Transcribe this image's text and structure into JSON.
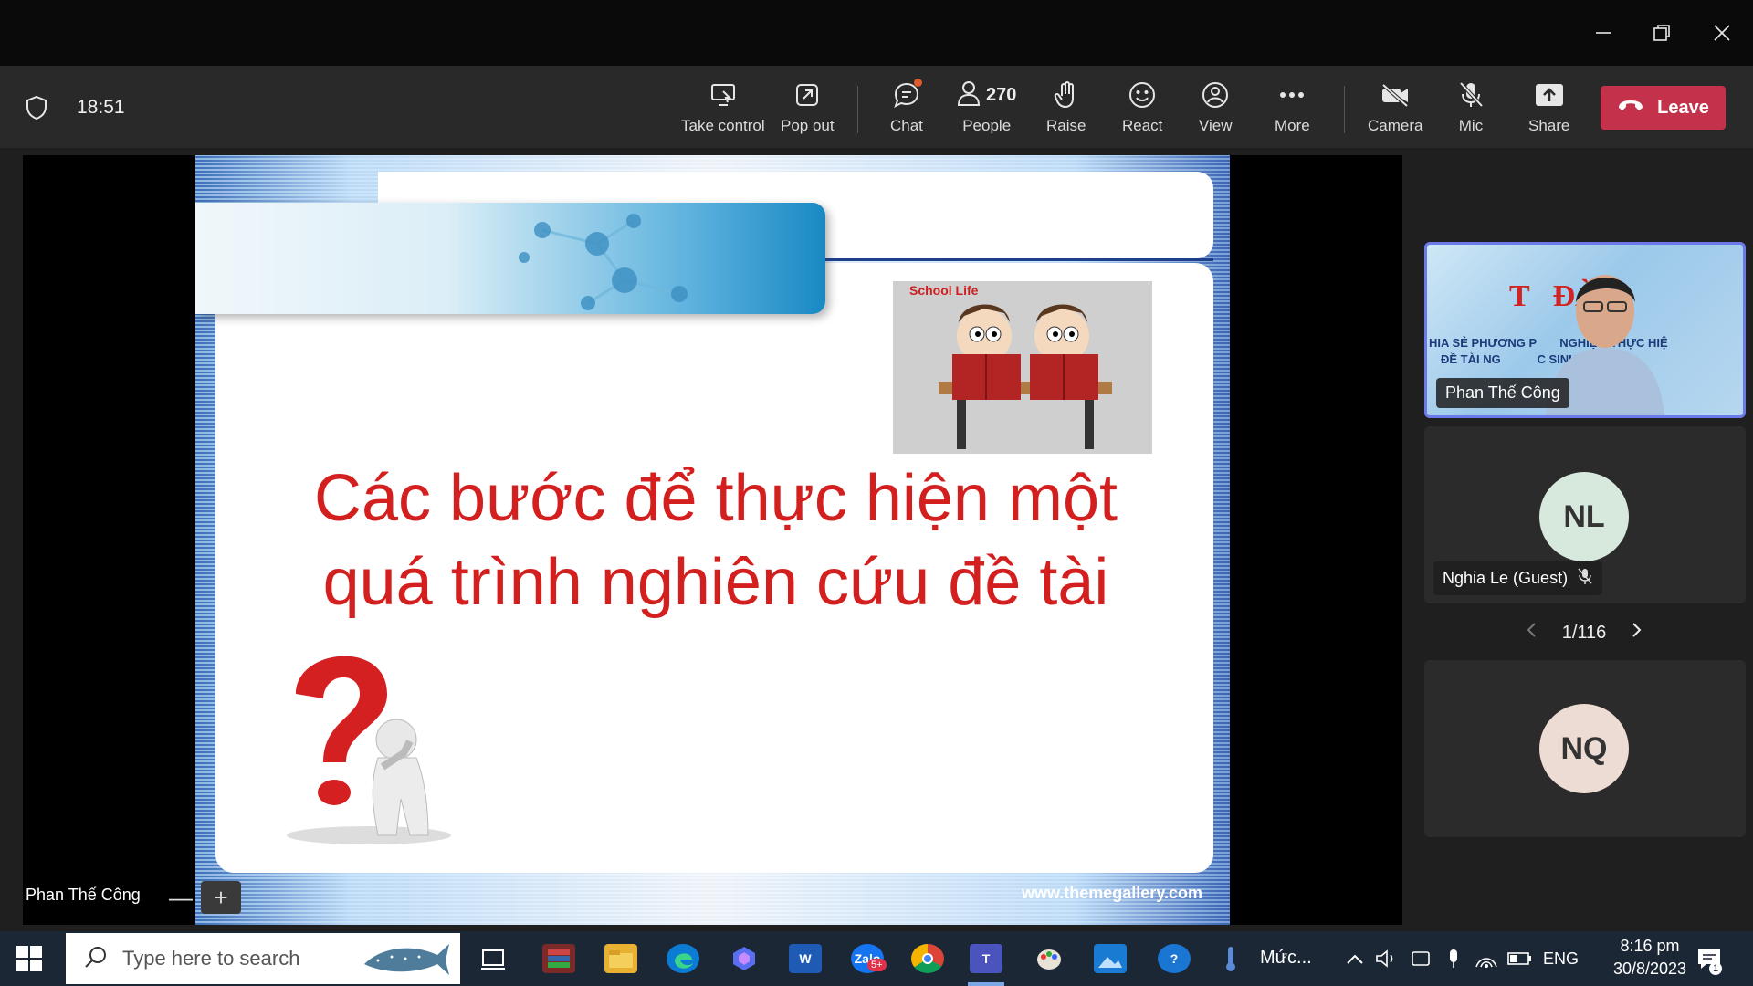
{
  "window": {
    "controls": [
      "minimize-icon",
      "restore-icon",
      "close-icon"
    ]
  },
  "toolbar": {
    "clock": "18:51",
    "items": [
      {
        "label": "Take control",
        "icon": "take-control-icon"
      },
      {
        "label": "Pop out",
        "icon": "pop-out-icon"
      },
      {
        "label": "Chat",
        "icon": "chat-icon"
      },
      {
        "label": "People",
        "icon": "people-icon",
        "count": "270"
      },
      {
        "label": "Raise",
        "icon": "hand-icon"
      },
      {
        "label": "React",
        "icon": "smiley-icon"
      },
      {
        "label": "View",
        "icon": "view-icon"
      },
      {
        "label": "More",
        "icon": "ellipsis-icon"
      },
      {
        "label": "Camera",
        "icon": "camera-off-icon"
      },
      {
        "label": "Mic",
        "icon": "mic-off-icon"
      },
      {
        "label": "Share",
        "icon": "share-icon"
      }
    ],
    "leave_label": "Leave"
  },
  "stage": {
    "slide": {
      "title_line1": "Các bước để thực hiện một",
      "title_line2": "quá trình nghiên cứu đề tài",
      "image_label": "School Life",
      "footer": "www.themegallery.com"
    },
    "presenter_name": "Phan Thế Công",
    "zoom_out": "—",
    "zoom_in": "+"
  },
  "participants": {
    "video_tile": {
      "name": "Phan Thế Công",
      "bg_title": "T   ĐÀM",
      "bg_line1": "HIA SẺ PHƯƠNG P       NGHIỆM THỰC HIỆ",
      "bg_line2": "ĐỀ TÀI NG           C SINH VIÊN"
    },
    "tile2": {
      "initials": "NL",
      "name": "Nghia Le (Guest)",
      "avatar_color": "#d7e9dd"
    },
    "tile3": {
      "initials": "NQ",
      "avatar_color": "#eddcd3"
    },
    "pager": "1/116"
  },
  "taskbar": {
    "search_placeholder": "Type here to search",
    "app_label": "Mức...",
    "lang": "ENG",
    "time": "8:16 pm",
    "date": "30/8/2023",
    "zalo_badge": "5+",
    "notif_count": "1"
  }
}
